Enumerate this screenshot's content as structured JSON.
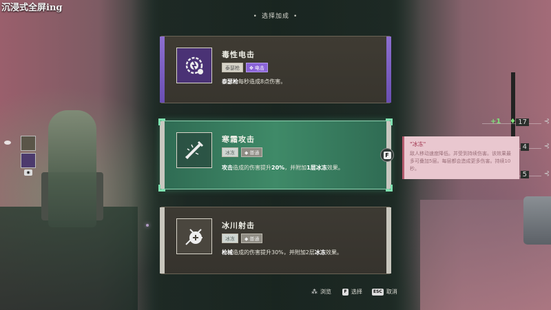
{
  "stream_title": "沉浸式全屏ing",
  "header": {
    "title": "选择加成",
    "dot": "•"
  },
  "left_buffs": {
    "key_hint": "◉"
  },
  "right_counters": [
    {
      "prefix": "+1",
      "value": "17"
    },
    {
      "value": "4"
    },
    {
      "value": "5"
    }
  ],
  "cards": [
    {
      "title": "毒性电击",
      "tags": [
        "泰瑟枪",
        "电击"
      ],
      "desc_bold": "泰瑟枪",
      "desc_rest": "每秒造成8点伤害。",
      "icon": "toxic-shock-icon",
      "rail_color": "#8d6fd0"
    },
    {
      "title": "寒霜攻击",
      "tags": [
        "冰冻",
        "普通"
      ],
      "desc_bold": "攻击",
      "desc_mid": "造成的伤害提升",
      "desc_pct": "20%",
      "desc_mid2": "，并附加",
      "desc_stack": "1层",
      "desc_effect": "冰冻",
      "desc_end": "效果。",
      "icon": "frost-blade-icon",
      "selected": true
    },
    {
      "title": "冰川射击",
      "tags": [
        "冰冻",
        "普通"
      ],
      "desc_bold": "枪械",
      "desc_mid": "造成的伤害提升30%，并附加2层",
      "desc_effect": "冰冻",
      "desc_end": "效果。",
      "icon": "glacier-shot-icon"
    }
  ],
  "select_key": "F",
  "tooltip": {
    "title": "\"冰冻\"",
    "body": "敌人移动速度降低。并受到持续伤害。该效果最多可叠加5层。每层都会造成更多伤害。持续10秒。"
  },
  "footer": {
    "browse": {
      "icon": "browse-icon",
      "label": "浏览"
    },
    "select": {
      "key": "F",
      "label": "选择"
    },
    "cancel": {
      "key": "ESC",
      "label": "取消"
    }
  }
}
